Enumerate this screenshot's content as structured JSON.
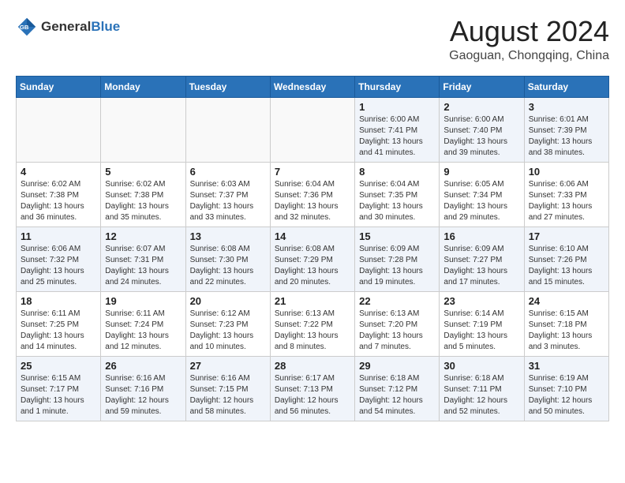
{
  "header": {
    "logo": {
      "general": "General",
      "blue": "Blue"
    },
    "title": "August 2024",
    "location": "Gaoguan, Chongqing, China"
  },
  "calendar": {
    "days_of_week": [
      "Sunday",
      "Monday",
      "Tuesday",
      "Wednesday",
      "Thursday",
      "Friday",
      "Saturday"
    ],
    "weeks": [
      [
        {
          "day": "",
          "info": ""
        },
        {
          "day": "",
          "info": ""
        },
        {
          "day": "",
          "info": ""
        },
        {
          "day": "",
          "info": ""
        },
        {
          "day": "1",
          "info": "Sunrise: 6:00 AM\nSunset: 7:41 PM\nDaylight: 13 hours\nand 41 minutes."
        },
        {
          "day": "2",
          "info": "Sunrise: 6:00 AM\nSunset: 7:40 PM\nDaylight: 13 hours\nand 39 minutes."
        },
        {
          "day": "3",
          "info": "Sunrise: 6:01 AM\nSunset: 7:39 PM\nDaylight: 13 hours\nand 38 minutes."
        }
      ],
      [
        {
          "day": "4",
          "info": "Sunrise: 6:02 AM\nSunset: 7:38 PM\nDaylight: 13 hours\nand 36 minutes."
        },
        {
          "day": "5",
          "info": "Sunrise: 6:02 AM\nSunset: 7:38 PM\nDaylight: 13 hours\nand 35 minutes."
        },
        {
          "day": "6",
          "info": "Sunrise: 6:03 AM\nSunset: 7:37 PM\nDaylight: 13 hours\nand 33 minutes."
        },
        {
          "day": "7",
          "info": "Sunrise: 6:04 AM\nSunset: 7:36 PM\nDaylight: 13 hours\nand 32 minutes."
        },
        {
          "day": "8",
          "info": "Sunrise: 6:04 AM\nSunset: 7:35 PM\nDaylight: 13 hours\nand 30 minutes."
        },
        {
          "day": "9",
          "info": "Sunrise: 6:05 AM\nSunset: 7:34 PM\nDaylight: 13 hours\nand 29 minutes."
        },
        {
          "day": "10",
          "info": "Sunrise: 6:06 AM\nSunset: 7:33 PM\nDaylight: 13 hours\nand 27 minutes."
        }
      ],
      [
        {
          "day": "11",
          "info": "Sunrise: 6:06 AM\nSunset: 7:32 PM\nDaylight: 13 hours\nand 25 minutes."
        },
        {
          "day": "12",
          "info": "Sunrise: 6:07 AM\nSunset: 7:31 PM\nDaylight: 13 hours\nand 24 minutes."
        },
        {
          "day": "13",
          "info": "Sunrise: 6:08 AM\nSunset: 7:30 PM\nDaylight: 13 hours\nand 22 minutes."
        },
        {
          "day": "14",
          "info": "Sunrise: 6:08 AM\nSunset: 7:29 PM\nDaylight: 13 hours\nand 20 minutes."
        },
        {
          "day": "15",
          "info": "Sunrise: 6:09 AM\nSunset: 7:28 PM\nDaylight: 13 hours\nand 19 minutes."
        },
        {
          "day": "16",
          "info": "Sunrise: 6:09 AM\nSunset: 7:27 PM\nDaylight: 13 hours\nand 17 minutes."
        },
        {
          "day": "17",
          "info": "Sunrise: 6:10 AM\nSunset: 7:26 PM\nDaylight: 13 hours\nand 15 minutes."
        }
      ],
      [
        {
          "day": "18",
          "info": "Sunrise: 6:11 AM\nSunset: 7:25 PM\nDaylight: 13 hours\nand 14 minutes."
        },
        {
          "day": "19",
          "info": "Sunrise: 6:11 AM\nSunset: 7:24 PM\nDaylight: 13 hours\nand 12 minutes."
        },
        {
          "day": "20",
          "info": "Sunrise: 6:12 AM\nSunset: 7:23 PM\nDaylight: 13 hours\nand 10 minutes."
        },
        {
          "day": "21",
          "info": "Sunrise: 6:13 AM\nSunset: 7:22 PM\nDaylight: 13 hours\nand 8 minutes."
        },
        {
          "day": "22",
          "info": "Sunrise: 6:13 AM\nSunset: 7:20 PM\nDaylight: 13 hours\nand 7 minutes."
        },
        {
          "day": "23",
          "info": "Sunrise: 6:14 AM\nSunset: 7:19 PM\nDaylight: 13 hours\nand 5 minutes."
        },
        {
          "day": "24",
          "info": "Sunrise: 6:15 AM\nSunset: 7:18 PM\nDaylight: 13 hours\nand 3 minutes."
        }
      ],
      [
        {
          "day": "25",
          "info": "Sunrise: 6:15 AM\nSunset: 7:17 PM\nDaylight: 13 hours\nand 1 minute."
        },
        {
          "day": "26",
          "info": "Sunrise: 6:16 AM\nSunset: 7:16 PM\nDaylight: 12 hours\nand 59 minutes."
        },
        {
          "day": "27",
          "info": "Sunrise: 6:16 AM\nSunset: 7:15 PM\nDaylight: 12 hours\nand 58 minutes."
        },
        {
          "day": "28",
          "info": "Sunrise: 6:17 AM\nSunset: 7:13 PM\nDaylight: 12 hours\nand 56 minutes."
        },
        {
          "day": "29",
          "info": "Sunrise: 6:18 AM\nSunset: 7:12 PM\nDaylight: 12 hours\nand 54 minutes."
        },
        {
          "day": "30",
          "info": "Sunrise: 6:18 AM\nSunset: 7:11 PM\nDaylight: 12 hours\nand 52 minutes."
        },
        {
          "day": "31",
          "info": "Sunrise: 6:19 AM\nSunset: 7:10 PM\nDaylight: 12 hours\nand 50 minutes."
        }
      ]
    ]
  }
}
